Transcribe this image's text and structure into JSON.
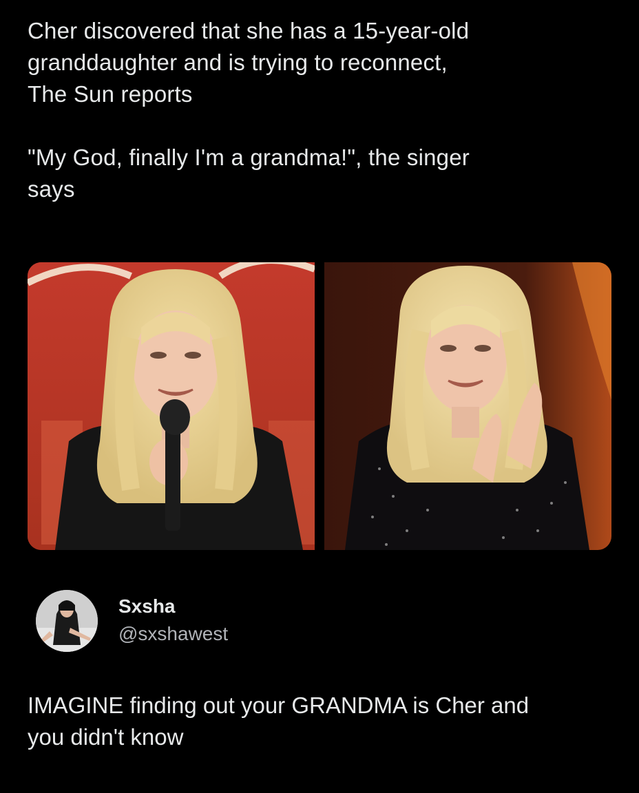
{
  "post": {
    "headline_line1": "Cher discovered that she has a 15-year-old",
    "headline_line2": "granddaughter and is trying to reconnect,",
    "headline_line3": "The Sun reports",
    "quote_line1": "\"My God, finally I'm a grandma!\", the singer",
    "quote_line2": "says"
  },
  "author": {
    "display_name": "Sxsha",
    "handle": "@sxshawest"
  },
  "reply": {
    "line1": "IMAGINE finding out your GRANDMA is Cher and",
    "line2": "you didn't know"
  },
  "colors": {
    "background": "#000000",
    "text": "#e7e9ea",
    "secondary_text": "#b0b3b8"
  }
}
